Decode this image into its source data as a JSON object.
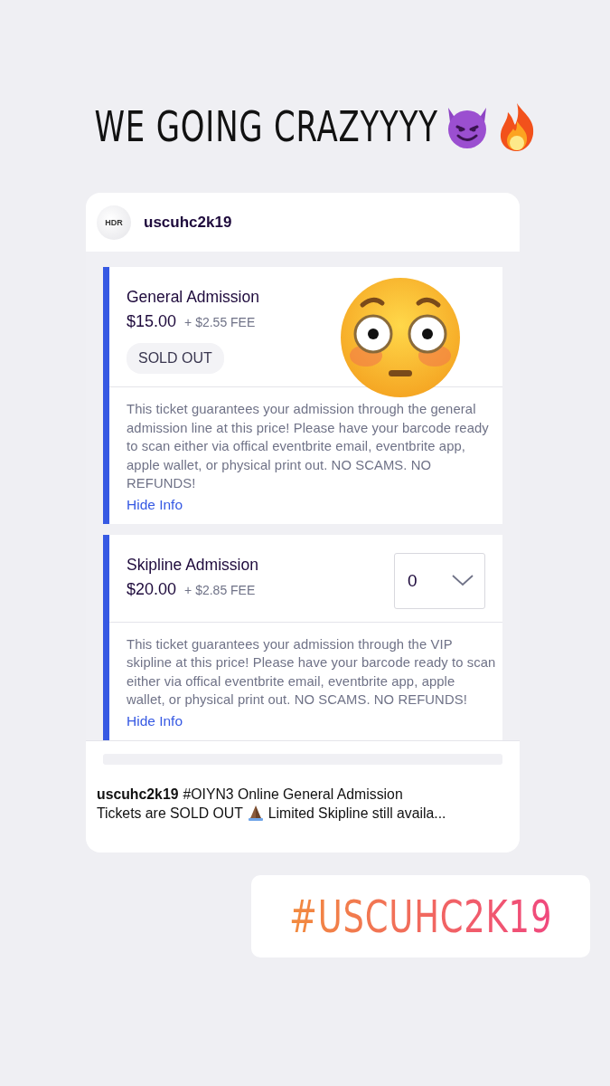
{
  "story_text": "WE GOING CRAZYYYY",
  "post": {
    "avatar_text": "HDR",
    "username": "uscuhc2k19",
    "tickets": [
      {
        "kind": "sold_out",
        "name": "General Admission",
        "price": "$15.00",
        "fee": "+ $2.55 FEE",
        "status": "SOLD OUT",
        "description": "This ticket guarantees your admission through the general admission line at this price! Please have your barcode ready to scan either via offical eventbrite email, eventbrite app, apple wallet, or physical print out. NO SCAMS. NO REFUNDS!",
        "link": "Hide Info"
      },
      {
        "kind": "select",
        "name": "Skipline Admission",
        "price": "$20.00",
        "fee": "+ $2.85 FEE",
        "quantity": "0",
        "description": "This ticket guarantees your admission through the VIP skipline at this price! Please have your barcode ready to scan either via offical eventbrite email, eventbrite app, apple wallet, or physical print out. NO SCAMS. NO REFUNDS!",
        "link": "Hide Info"
      }
    ],
    "caption": {
      "username": "uscuhc2k19",
      "text_line_1": "#OIYN3 Online General Admission",
      "text_before": "Tickets are SOLD OUT",
      "text_after": "Limited Skipline still availa..."
    }
  },
  "hashtag": "#USCUHC2K19"
}
